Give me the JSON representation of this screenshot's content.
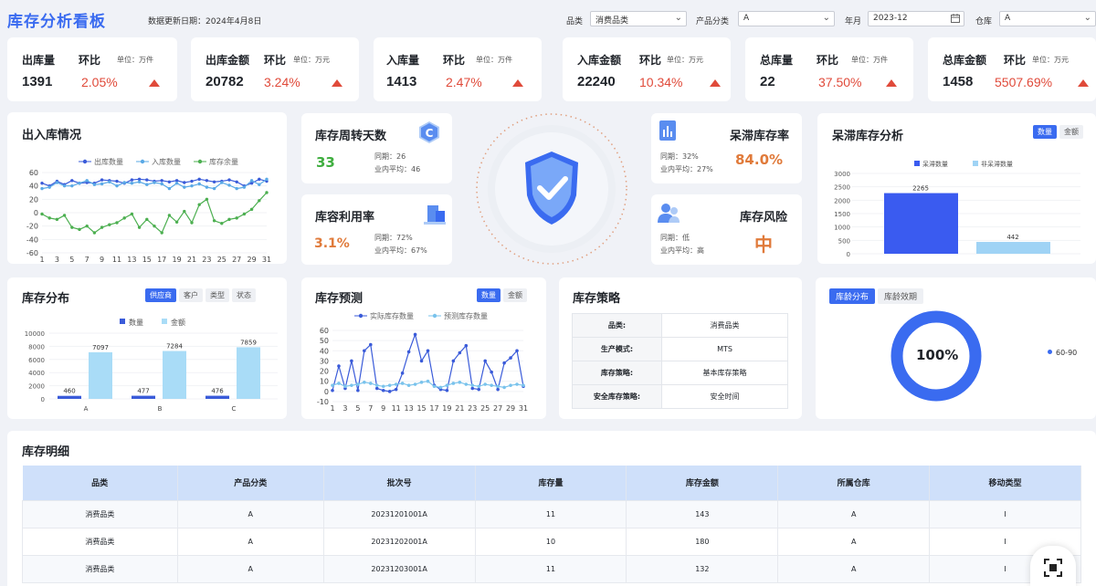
{
  "header": {
    "title": "库存分析看板",
    "update_text": "数据更新日期：2024年4月8日",
    "filters": [
      {
        "label": "品类",
        "value": "消费品类"
      },
      {
        "label": "产品分类",
        "value": "A"
      },
      {
        "label": "年月",
        "value": "2023-12"
      },
      {
        "label": "仓库",
        "value": "A"
      }
    ]
  },
  "kpis": [
    {
      "title": "出库量",
      "mom_label": "环比",
      "unit": "单位：万件",
      "value": "1391",
      "pct": "2.05%"
    },
    {
      "title": "出库金额",
      "mom_label": "环比",
      "unit": "单位：万元",
      "value": "20782",
      "pct": "3.24%"
    },
    {
      "title": "入库量",
      "mom_label": "环比",
      "unit": "单位：万件",
      "value": "1413",
      "pct": "2.47%"
    },
    {
      "title": "入库金额",
      "mom_label": "环比",
      "unit": "单位：万元",
      "value": "22240",
      "pct": "10.34%"
    },
    {
      "title": "总库量",
      "mom_label": "环比",
      "unit": "单位：万件",
      "value": "22",
      "pct": "37.50%"
    },
    {
      "title": "总库金额",
      "mom_label": "环比",
      "unit": "单位：万元",
      "value": "1458",
      "pct": "5507.69%"
    }
  ],
  "inout": {
    "title": "出入库情况",
    "legend": [
      "出库数量",
      "入库数量",
      "库存余量"
    ],
    "colors": [
      "#3a5bd9",
      "#5aa9e6",
      "#4caf50"
    ]
  },
  "turnover": {
    "title": "库存周转天数",
    "value": "33",
    "yoy": "同期：26",
    "avg": "业内平均：46"
  },
  "capacity": {
    "title": "库容利用率",
    "value": "3.1%",
    "yoy": "同期：72%",
    "avg": "业内平均：67%"
  },
  "stagnant_rate": {
    "title": "呆滞库存率",
    "value": "84.0%",
    "yoy": "同期：32%",
    "avg": "业内平均：27%"
  },
  "risk": {
    "title": "库存风险",
    "value": "中",
    "yoy": "同期：低",
    "avg": "业内平均：高"
  },
  "stagnant_analysis": {
    "title": "呆滞库存分析",
    "tabs": [
      "数量",
      "金额"
    ]
  },
  "distribution": {
    "title": "库存分布",
    "tabs": [
      "供应商",
      "客户",
      "类型",
      "状态"
    ]
  },
  "forecast": {
    "title": "库存预测",
    "tabs": [
      "数量",
      "金额"
    ]
  },
  "strategy": {
    "title": "库存策略",
    "rows": [
      {
        "k": "品类:",
        "v": "消费品类"
      },
      {
        "k": "生产模式:",
        "v": "MTS"
      },
      {
        "k": "库存策略:",
        "v": "基本库存策略"
      },
      {
        "k": "安全库存策略:",
        "v": "安全时间"
      }
    ]
  },
  "age": {
    "tabs": [
      "库龄分布",
      "库龄效期"
    ],
    "center": "100%",
    "legend": "60-90",
    "color": "#3a6bf0"
  },
  "detail": {
    "title": "库存明细",
    "columns": [
      "品类",
      "产品分类",
      "批次号",
      "库存量",
      "库存金额",
      "所属仓库",
      "移动类型"
    ],
    "rows": [
      [
        "消费品类",
        "A",
        "20231201001A",
        "11",
        "143",
        "A",
        "I"
      ],
      [
        "消费品类",
        "A",
        "20231202001A",
        "10",
        "180",
        "A",
        "I"
      ],
      [
        "消费品类",
        "A",
        "20231203001A",
        "11",
        "132",
        "A",
        "I"
      ]
    ]
  },
  "chart_data": [
    {
      "type": "line",
      "name_ref": "出入库情况",
      "x": [
        1,
        2,
        3,
        4,
        5,
        6,
        7,
        8,
        9,
        10,
        11,
        12,
        13,
        14,
        15,
        16,
        17,
        18,
        19,
        20,
        21,
        22,
        23,
        24,
        25,
        26,
        27,
        28,
        29,
        30,
        31
      ],
      "x_tick_labels": [
        "1",
        "3",
        "5",
        "7",
        "9",
        "11",
        "13",
        "15",
        "17",
        "19",
        "21",
        "23",
        "25",
        "27",
        "29",
        "31"
      ],
      "ylim": [
        -60,
        60
      ],
      "y_ticks": [
        60,
        40,
        20,
        0,
        -20,
        -40,
        -60
      ],
      "series": [
        {
          "name": "出库数量",
          "values": [
            44,
            40,
            47,
            42,
            48,
            44,
            45,
            44,
            49,
            48,
            47,
            44,
            49,
            50,
            49,
            47,
            48,
            46,
            48,
            45,
            47,
            50,
            48,
            46,
            47,
            49,
            46,
            40,
            44,
            50,
            47
          ]
        },
        {
          "name": "入库数量",
          "values": [
            36,
            38,
            45,
            40,
            40,
            44,
            48,
            42,
            43,
            46,
            40,
            45,
            44,
            46,
            42,
            45,
            43,
            36,
            44,
            38,
            40,
            43,
            38,
            36,
            45,
            41,
            36,
            38,
            48,
            42,
            50
          ]
        },
        {
          "name": "库存余量",
          "values": [
            -2,
            -8,
            -10,
            -4,
            -22,
            -25,
            -20,
            -30,
            -22,
            -18,
            -15,
            -8,
            -2,
            -22,
            -10,
            -20,
            -30,
            -4,
            -14,
            2,
            -15,
            12,
            20,
            -12,
            -16,
            -10,
            -8,
            -2,
            5,
            18,
            30
          ]
        }
      ]
    },
    {
      "type": "bar",
      "name_ref": "呆滞库存分析",
      "categories": [
        ""
      ],
      "ylim": [
        0,
        3000
      ],
      "y_ticks": [
        3000,
        2500,
        2000,
        1500,
        1000,
        500,
        0
      ],
      "series": [
        {
          "name": "呆滞数量",
          "values": [
            2265
          ],
          "color": "#3a5bf0"
        },
        {
          "name": "非呆滞数量",
          "values": [
            442
          ],
          "color": "#9fd3f5"
        }
      ]
    },
    {
      "type": "bar",
      "name_ref": "库存分布",
      "categories": [
        "A",
        "B",
        "C"
      ],
      "ylim": [
        0,
        10000
      ],
      "y_ticks": [
        10000,
        8000,
        6000,
        4000,
        2000,
        0
      ],
      "series": [
        {
          "name": "数量",
          "values": [
            460,
            477,
            476
          ],
          "color": "#3a5bd9"
        },
        {
          "name": "金额",
          "values": [
            7097,
            7284,
            7859
          ],
          "color": "#a9dcf7"
        }
      ]
    },
    {
      "type": "line",
      "name_ref": "库存预测",
      "x": [
        1,
        2,
        3,
        4,
        5,
        6,
        7,
        8,
        9,
        10,
        11,
        12,
        13,
        14,
        15,
        16,
        17,
        18,
        19,
        20,
        21,
        22,
        23,
        24,
        25,
        26,
        27,
        28,
        29,
        30,
        31
      ],
      "x_tick_labels": [
        "1",
        "3",
        "5",
        "7",
        "9",
        "11",
        "13",
        "15",
        "17",
        "19",
        "21",
        "23",
        "25",
        "27",
        "29",
        "31"
      ],
      "ylim": [
        -10,
        60
      ],
      "y_ticks": [
        60,
        50,
        40,
        30,
        20,
        10,
        0,
        -10
      ],
      "series": [
        {
          "name": "实际库存数量",
          "values": [
            1,
            25,
            3,
            30,
            1,
            40,
            46,
            3,
            1,
            0,
            2,
            18,
            39,
            56,
            30,
            40,
            6,
            2,
            1,
            30,
            38,
            45,
            3,
            2,
            30,
            19,
            2,
            28,
            33,
            40,
            5
          ]
        },
        {
          "name": "预测库存数量",
          "values": [
            6,
            8,
            5,
            6,
            7,
            9,
            8,
            6,
            5,
            6,
            7,
            8,
            6,
            7,
            9,
            10,
            5,
            4,
            6,
            8,
            9,
            7,
            6,
            5,
            7,
            6,
            5,
            4,
            6,
            7,
            6
          ]
        }
      ]
    },
    {
      "type": "pie",
      "name_ref": "库龄分布",
      "categories": [
        "60-90"
      ],
      "values": [
        100
      ]
    }
  ]
}
